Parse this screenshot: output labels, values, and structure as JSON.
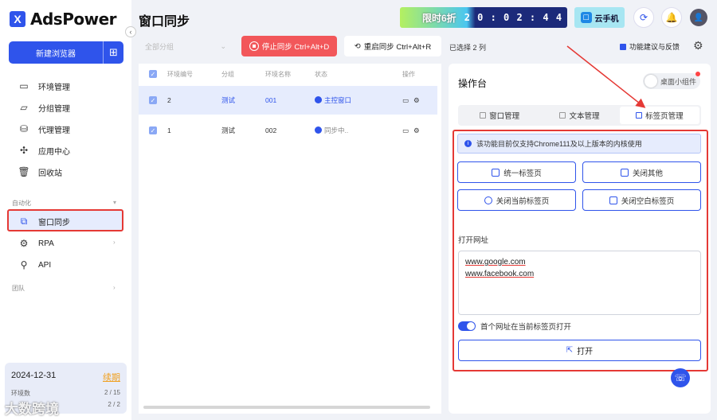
{
  "app": {
    "name": "AdsPower",
    "logo_letter": "X"
  },
  "sidebar": {
    "new_browser_label": "新建浏览器",
    "items": [
      {
        "label": "环境管理",
        "icon": "folder-icon"
      },
      {
        "label": "分组管理",
        "icon": "folder-open-icon"
      },
      {
        "label": "代理管理",
        "icon": "proxy-icon"
      },
      {
        "label": "应用中心",
        "icon": "puzzle-icon"
      },
      {
        "label": "回收站",
        "icon": "trash-icon"
      }
    ],
    "section_automation": "自动化",
    "automation_items": [
      {
        "label": "窗口同步",
        "icon": "sync-windows-icon",
        "active": true
      },
      {
        "label": "RPA",
        "icon": "robot-icon"
      },
      {
        "label": "API",
        "icon": "api-icon"
      }
    ],
    "section_team": "团队",
    "account": {
      "date": "2024-12-31",
      "renew": "续期",
      "env_label": "环境数",
      "env_value": "2 / 15",
      "second_value": "2 / 2"
    },
    "watermark": "大数跨境"
  },
  "header": {
    "title": "窗口同步",
    "promo_text": "限时6折",
    "countdown": "2 0 : 0 2 : 4 4",
    "cloud_phone": "云手机"
  },
  "toolbar": {
    "group_placeholder": "全部分组",
    "stop_sync": "停止同步 Ctrl+Alt+D",
    "restart_sync": "重启同步 Ctrl+Alt+R",
    "selected": "已选择 2 列",
    "feedback": "功能建议与反馈"
  },
  "table": {
    "headers": [
      "环境编号",
      "分组",
      "环境名称",
      "状态",
      "操作"
    ],
    "rows": [
      {
        "id": "2",
        "group": "测试",
        "name": "001",
        "status": "主控窗口",
        "selected": true
      },
      {
        "id": "1",
        "group": "测试",
        "name": "002",
        "status": "同步中..",
        "selected": true
      }
    ]
  },
  "panel": {
    "title": "操作台",
    "widget_label": "桌面小组件",
    "tabs": [
      "窗口管理",
      "文本管理",
      "标签页管理"
    ],
    "active_tab": 2,
    "info": "该功能目前仅支持Chrome111及以上版本的内核使用",
    "actions": [
      "统一标签页",
      "关闭其他",
      "关闭当前标签页",
      "关闭空白标签页"
    ],
    "open_url_label": "打开网址",
    "urls": [
      "www.google.com",
      "www.facebook.com"
    ],
    "first_url_current_tab": "首个网址在当前标签页打开",
    "open_button": "打开"
  },
  "colors": {
    "accent": "#2f54eb",
    "highlight": "#e53935",
    "stop": "#f2575a"
  }
}
